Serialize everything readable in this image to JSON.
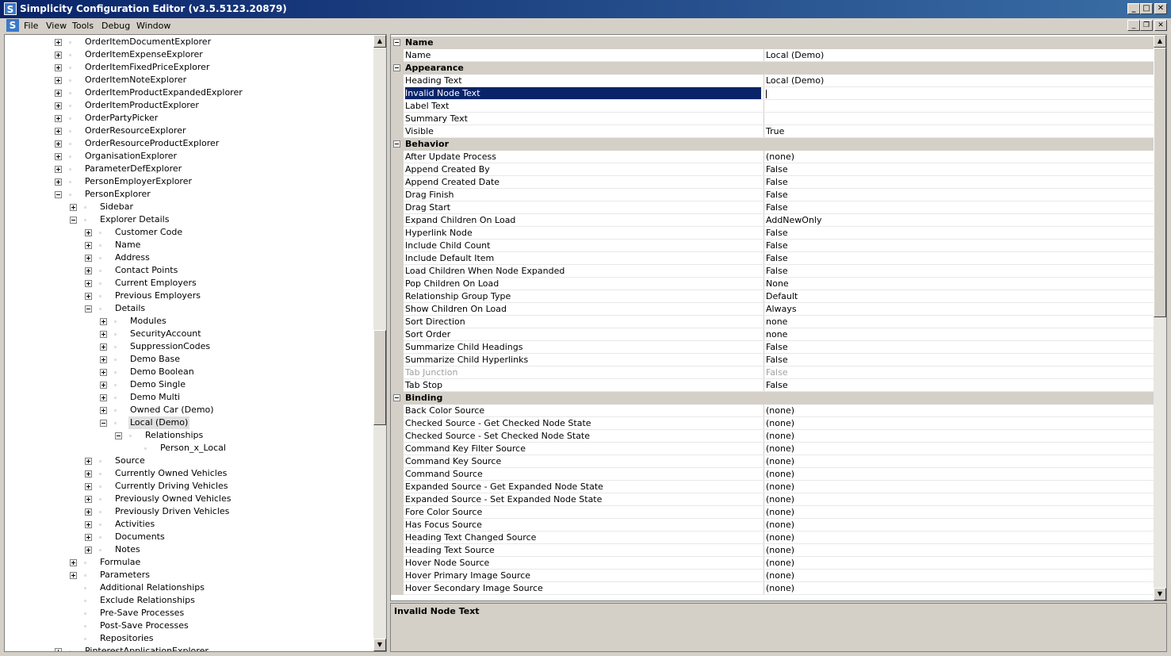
{
  "window": {
    "title": "Simplicity Configuration Editor (v3.5.5123.20879)"
  },
  "menu": [
    "File",
    "View",
    "Tools",
    "Debug",
    "Window"
  ],
  "tree": [
    {
      "label": "OrderItemDocumentExplorer",
      "level": 0,
      "exp": "plus"
    },
    {
      "label": "OrderItemExpenseExplorer",
      "level": 0,
      "exp": "plus"
    },
    {
      "label": "OrderItemFixedPriceExplorer",
      "level": 0,
      "exp": "plus"
    },
    {
      "label": "OrderItemNoteExplorer",
      "level": 0,
      "exp": "plus"
    },
    {
      "label": "OrderItemProductExpandedExplorer",
      "level": 0,
      "exp": "plus"
    },
    {
      "label": "OrderItemProductExplorer",
      "level": 0,
      "exp": "plus"
    },
    {
      "label": "OrderPartyPicker",
      "level": 0,
      "exp": "plus"
    },
    {
      "label": "OrderResourceExplorer",
      "level": 0,
      "exp": "plus"
    },
    {
      "label": "OrderResourceProductExplorer",
      "level": 0,
      "exp": "plus"
    },
    {
      "label": "OrganisationExplorer",
      "level": 0,
      "exp": "plus"
    },
    {
      "label": "ParameterDefExplorer",
      "level": 0,
      "exp": "plus"
    },
    {
      "label": "PersonEmployerExplorer",
      "level": 0,
      "exp": "plus"
    },
    {
      "label": "PersonExplorer",
      "level": 0,
      "exp": "minus"
    },
    {
      "label": "Sidebar",
      "level": 1,
      "exp": "plus"
    },
    {
      "label": "Explorer Details",
      "level": 1,
      "exp": "minus"
    },
    {
      "label": "Customer Code",
      "level": 2,
      "exp": "plus"
    },
    {
      "label": "Name",
      "level": 2,
      "exp": "plus"
    },
    {
      "label": "Address",
      "level": 2,
      "exp": "plus"
    },
    {
      "label": "Contact Points",
      "level": 2,
      "exp": "plus"
    },
    {
      "label": "Current Employers",
      "level": 2,
      "exp": "plus"
    },
    {
      "label": "Previous Employers",
      "level": 2,
      "exp": "plus"
    },
    {
      "label": "Details",
      "level": 2,
      "exp": "minus"
    },
    {
      "label": "Modules",
      "level": 3,
      "exp": "plus"
    },
    {
      "label": "SecurityAccount",
      "level": 3,
      "exp": "plus"
    },
    {
      "label": "SuppressionCodes",
      "level": 3,
      "exp": "plus"
    },
    {
      "label": "Demo Base",
      "level": 3,
      "exp": "plus"
    },
    {
      "label": "Demo Boolean",
      "level": 3,
      "exp": "plus"
    },
    {
      "label": "Demo Single",
      "level": 3,
      "exp": "plus"
    },
    {
      "label": "Demo Multi",
      "level": 3,
      "exp": "plus"
    },
    {
      "label": "Owned Car (Demo)",
      "level": 3,
      "exp": "plus"
    },
    {
      "label": "Local (Demo)",
      "level": 3,
      "exp": "minus",
      "selected": true
    },
    {
      "label": "Relationships",
      "level": 4,
      "exp": "minus"
    },
    {
      "label": "Person_x_Local",
      "level": 5,
      "exp": "none"
    },
    {
      "label": "Source",
      "level": 2,
      "exp": "plus"
    },
    {
      "label": "Currently Owned Vehicles",
      "level": 2,
      "exp": "plus"
    },
    {
      "label": "Currently Driving Vehicles",
      "level": 2,
      "exp": "plus"
    },
    {
      "label": "Previously Owned Vehicles",
      "level": 2,
      "exp": "plus"
    },
    {
      "label": "Previously Driven Vehicles",
      "level": 2,
      "exp": "plus"
    },
    {
      "label": "Activities",
      "level": 2,
      "exp": "plus"
    },
    {
      "label": "Documents",
      "level": 2,
      "exp": "plus"
    },
    {
      "label": "Notes",
      "level": 2,
      "exp": "plus"
    },
    {
      "label": "Formulae",
      "level": 1,
      "exp": "plus"
    },
    {
      "label": "Parameters",
      "level": 1,
      "exp": "plus"
    },
    {
      "label": "Additional Relationships",
      "level": 1,
      "exp": "none"
    },
    {
      "label": "Exclude Relationships",
      "level": 1,
      "exp": "none"
    },
    {
      "label": "Pre-Save Processes",
      "level": 1,
      "exp": "none"
    },
    {
      "label": "Post-Save Processes",
      "level": 1,
      "exp": "none"
    },
    {
      "label": "Repositories",
      "level": 1,
      "exp": "none"
    },
    {
      "label": "PinterestApplicationExplorer",
      "level": 0,
      "exp": "plus"
    }
  ],
  "properties": [
    {
      "type": "cat",
      "name": "Name"
    },
    {
      "type": "item",
      "name": "Name",
      "value": "Local (Demo)"
    },
    {
      "type": "cat",
      "name": "Appearance"
    },
    {
      "type": "item",
      "name": "Heading Text",
      "value": "Local (Demo)"
    },
    {
      "type": "item",
      "name": "Invalid Node Text",
      "value": "",
      "selected": true
    },
    {
      "type": "item",
      "name": "Label Text",
      "value": ""
    },
    {
      "type": "item",
      "name": "Summary Text",
      "value": ""
    },
    {
      "type": "item",
      "name": "Visible",
      "value": "True"
    },
    {
      "type": "cat",
      "name": "Behavior"
    },
    {
      "type": "item",
      "name": "After Update Process",
      "value": "(none)"
    },
    {
      "type": "item",
      "name": "Append Created By",
      "value": "False"
    },
    {
      "type": "item",
      "name": "Append Created Date",
      "value": "False"
    },
    {
      "type": "item",
      "name": "Drag Finish",
      "value": "False"
    },
    {
      "type": "item",
      "name": "Drag Start",
      "value": "False"
    },
    {
      "type": "item",
      "name": "Expand Children On Load",
      "value": "AddNewOnly"
    },
    {
      "type": "item",
      "name": "Hyperlink Node",
      "value": "False"
    },
    {
      "type": "item",
      "name": "Include Child Count",
      "value": "False"
    },
    {
      "type": "item",
      "name": "Include Default Item",
      "value": "False"
    },
    {
      "type": "item",
      "name": "Load Children When Node Expanded",
      "value": "False"
    },
    {
      "type": "item",
      "name": "Pop Children On Load",
      "value": "None"
    },
    {
      "type": "item",
      "name": "Relationship Group Type",
      "value": "Default"
    },
    {
      "type": "item",
      "name": "Show Children On Load",
      "value": "Always"
    },
    {
      "type": "item",
      "name": "Sort Direction",
      "value": "none"
    },
    {
      "type": "item",
      "name": "Sort Order",
      "value": "none"
    },
    {
      "type": "item",
      "name": "Summarize Child Headings",
      "value": "False"
    },
    {
      "type": "item",
      "name": "Summarize Child Hyperlinks",
      "value": "False"
    },
    {
      "type": "item",
      "name": "Tab Junction",
      "value": "False",
      "disabled": true
    },
    {
      "type": "item",
      "name": "Tab Stop",
      "value": "False"
    },
    {
      "type": "cat",
      "name": "Binding"
    },
    {
      "type": "item",
      "name": "Back Color Source",
      "value": "(none)"
    },
    {
      "type": "item",
      "name": "Checked Source - Get Checked Node State",
      "value": "(none)"
    },
    {
      "type": "item",
      "name": "Checked Source - Set Checked Node State",
      "value": "(none)"
    },
    {
      "type": "item",
      "name": "Command Key Filter Source",
      "value": "(none)"
    },
    {
      "type": "item",
      "name": "Command Key Source",
      "value": "(none)"
    },
    {
      "type": "item",
      "name": "Command Source",
      "value": "(none)"
    },
    {
      "type": "item",
      "name": "Expanded Source - Get Expanded Node State",
      "value": "(none)"
    },
    {
      "type": "item",
      "name": "Expanded Source - Set Expanded Node State",
      "value": "(none)"
    },
    {
      "type": "item",
      "name": "Fore Color Source",
      "value": "(none)"
    },
    {
      "type": "item",
      "name": "Has Focus Source",
      "value": "(none)"
    },
    {
      "type": "item",
      "name": "Heading Text Changed Source",
      "value": "(none)"
    },
    {
      "type": "item",
      "name": "Heading Text Source",
      "value": "(none)"
    },
    {
      "type": "item",
      "name": "Hover Node Source",
      "value": "(none)"
    },
    {
      "type": "item",
      "name": "Hover Primary Image Source",
      "value": "(none)"
    },
    {
      "type": "item",
      "name": "Hover Secondary Image Source",
      "value": "(none)"
    }
  ],
  "description": {
    "title": "Invalid Node Text"
  }
}
